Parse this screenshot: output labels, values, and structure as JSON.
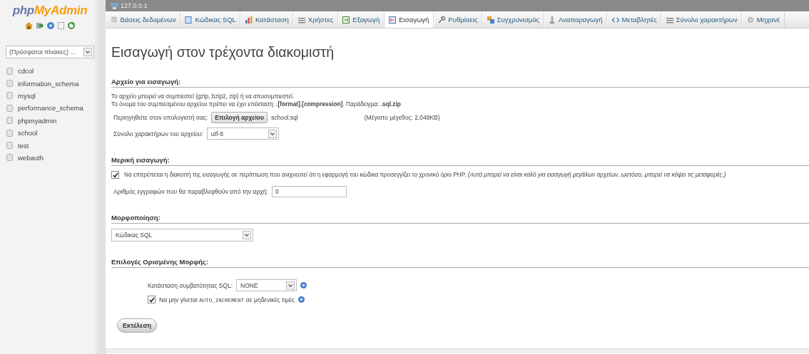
{
  "sidebar": {
    "logo_prefix": "php",
    "logo_main": "MyAdmin",
    "recent_tables": {
      "value": "(Πρόσφατοι πίνακες) ..."
    },
    "databases": [
      "cdcol",
      "information_schema",
      "mysql",
      "performance_schema",
      "phpmyadmin",
      "school",
      "test",
      "webauth"
    ]
  },
  "server": {
    "title": "127.0.0.1"
  },
  "tabs": [
    {
      "label": "Βάσεις δεδομένων",
      "selected": false
    },
    {
      "label": "Κώδικας SQL",
      "selected": false
    },
    {
      "label": "Κατάσταση",
      "selected": false
    },
    {
      "label": "Χρήστες",
      "selected": false
    },
    {
      "label": "Εξαγωγή",
      "selected": false
    },
    {
      "label": "Εισαγωγή",
      "selected": true
    },
    {
      "label": "Ρυθμίσεις",
      "selected": false
    },
    {
      "label": "Συγχρονισμός",
      "selected": false
    },
    {
      "label": "Αναπαραγωγή",
      "selected": false
    },
    {
      "label": "Μεταβλητές",
      "selected": false
    },
    {
      "label": "Σύνολο χαρακτήρων",
      "selected": false
    },
    {
      "label": "Μηχανέ",
      "selected": false
    }
  ],
  "page_title": "Εισαγωγή στον τρέχοντα διακομιστή",
  "file_section": {
    "legend": "Αρχείο για εισαγωγή:",
    "notes": [
      "Το αρχείο μπορεί να συμπιεστεί (gzip, bzip2, zip) ή να αποσυμπιεστεί.",
      "Το όνομα του συμπιεσμένου αρχείου πρέπει να έχει επέκταση: **.[format].[compression]**. Παράδειγμα: **.sql.zip**"
    ],
    "browse_label": "Περιηγηθείτε στον υπολογιστή σας:",
    "choose_button": "Επιλογή αρχείου",
    "file_name": "school.sql",
    "max_size": "(Μέγιστο μέγεθος: 2,048KB)",
    "charset_label": "Σύνολο χαρακτήρων του αρχείου:",
    "charset_value": "utf-8"
  },
  "partial_section": {
    "legend": "Μερική εισαγωγή:",
    "allow_interrupt": {
      "checked": true,
      "label": "Να επιτρέπεται η διακοπή της εισαγωγής σε περίπτωση που ανιχνευτεί ότι η εφαρμογή του κώδικα προσεγγίζει το χρονικό όριο PHP. *(Αυτό μπορεί να είναι καλό για εισαγωγή μεγάλων αρχείων, ωστόσο, μπορεί να κόψει τις μεταφορές.)*"
    },
    "skip_label": "Αριθμός εγγραφών που θα παραβλεφθούν από την αρχή:",
    "skip_value": "0"
  },
  "format_section": {
    "legend": "Μορφοποίηση:",
    "format_value": "Κώδικας SQL"
  },
  "options_section": {
    "legend": "Επιλογές Ορισμένης Μορφής:",
    "compat_label": "Κατάσταση συμβατότητας SQL:",
    "compat_value": "NONE",
    "no_auto_zero": {
      "checked": true,
      "label_parts": [
        "Να μην γίνεται ",
        "AUTO_INCREMENT",
        " σε μηδενικές τιμές"
      ]
    }
  },
  "submit_button": "Εκτέλεση"
}
